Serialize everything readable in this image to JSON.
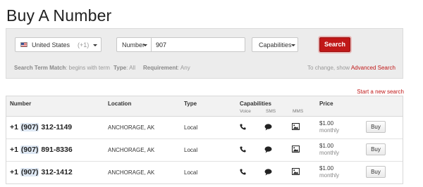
{
  "page": {
    "title": "Buy A Number"
  },
  "search": {
    "country": {
      "name": "United States",
      "code": "(+1)"
    },
    "filter_label": "Number",
    "query": "907",
    "capabilities_label": "Capabilities",
    "search_label": "Search",
    "criteria": {
      "match_label": "Search Term Match",
      "match_value": ": begins with term",
      "type_label": "Type",
      "type_value": ": All",
      "requirement_label": "Requirement",
      "requirement_value": ": Any"
    },
    "change_hint": "To change, show ",
    "advanced_link": "Advanced Search"
  },
  "start_new_link": "Start a new search",
  "table": {
    "headers": {
      "number": "Number",
      "location": "Location",
      "type": "Type",
      "capabilities": "Capabilities",
      "price": "Price",
      "voice": "Voice",
      "sms": "SMS",
      "mms": "MMS"
    },
    "rows": [
      {
        "prefix": "+1 ",
        "area": "(907)",
        "rest": " 312-1149",
        "location": "ANCHORAGE, AK",
        "type": "Local",
        "price": "$1.00",
        "period": "monthly",
        "buy": "Buy"
      },
      {
        "prefix": "+1 ",
        "area": "(907)",
        "rest": " 891-8336",
        "location": "ANCHORAGE, AK",
        "type": "Local",
        "price": "$1.00",
        "period": "monthly",
        "buy": "Buy"
      },
      {
        "prefix": "+1 ",
        "area": "(907)",
        "rest": " 312-1412",
        "location": "ANCHORAGE, AK",
        "type": "Local",
        "price": "$1.00",
        "period": "monthly",
        "buy": "Buy"
      }
    ]
  },
  "icons": {
    "voice": "phone-icon",
    "sms": "chat-icon",
    "mms": "image-icon",
    "country": "us-flag-icon"
  },
  "colors": {
    "accent": "#c01818",
    "panel": "#ececec",
    "area_highlight": "#dfe9f5"
  }
}
